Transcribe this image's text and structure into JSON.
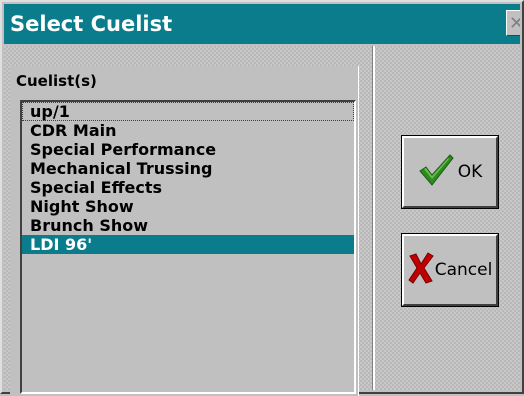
{
  "window": {
    "title": "Select Cuelist",
    "close_glyph": "✕"
  },
  "panel": {
    "label": "Cuelist(s)"
  },
  "cuelists": [
    {
      "label": "up/1",
      "selected": false
    },
    {
      "label": "CDR Main",
      "selected": false
    },
    {
      "label": "Special Performance",
      "selected": false
    },
    {
      "label": "Mechanical Trussing",
      "selected": false
    },
    {
      "label": "Special Effects",
      "selected": false
    },
    {
      "label": "Night Show",
      "selected": false
    },
    {
      "label": "Brunch Show",
      "selected": false
    },
    {
      "label": "LDI 96'",
      "selected": true
    }
  ],
  "buttons": {
    "ok": {
      "label": "OK",
      "icon": "checkmark-icon"
    },
    "cancel": {
      "label": "Cancel",
      "icon": "x-mark-icon"
    }
  },
  "colors": {
    "titlebar": "#0a7c8c",
    "selection": "#0a7c8c",
    "check_green": "#2e8b1e",
    "x_red": "#c00000"
  }
}
